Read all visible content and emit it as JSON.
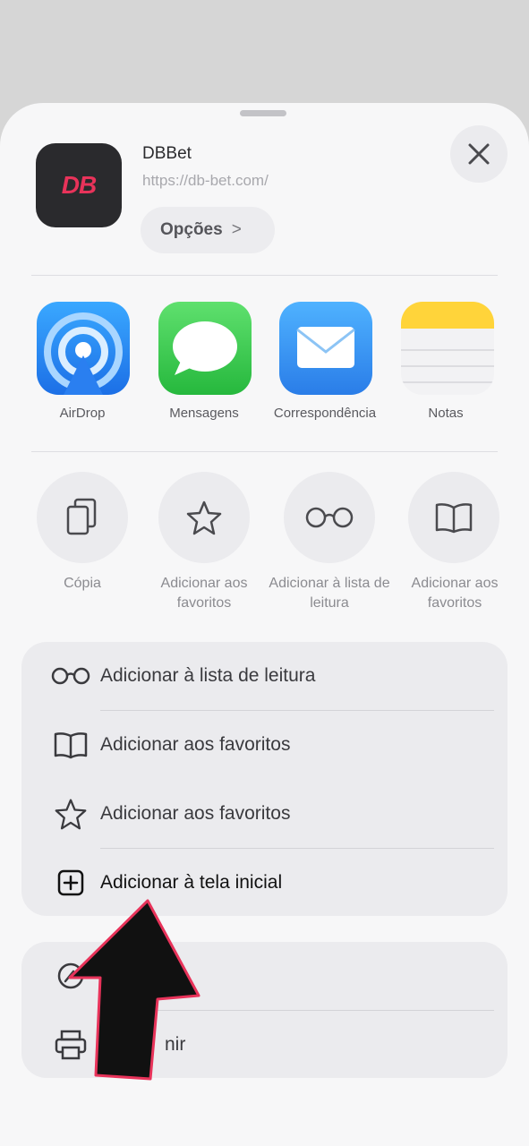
{
  "share_sheet": {
    "app": {
      "icon_text": "DB",
      "name": "DBBet",
      "url": "https://db-bet.com/",
      "options_label": "Opções",
      "options_chevron": ">"
    },
    "share_targets": [
      {
        "label": "AirDrop",
        "icon": "airdrop-icon"
      },
      {
        "label": "Mensagens",
        "icon": "messages-icon"
      },
      {
        "label": "Correspondência",
        "icon": "mail-icon"
      },
      {
        "label": "Notas",
        "icon": "notes-icon"
      }
    ],
    "actions": [
      {
        "label": "Cópia",
        "icon": "copy-icon"
      },
      {
        "label": "Adicionar aos favoritos",
        "icon": "star-icon"
      },
      {
        "label": "Adicionar à lista de leitura",
        "icon": "glasses-icon"
      },
      {
        "label": "Adicionar aos favoritos",
        "icon": "book-icon"
      }
    ],
    "menu_rows": [
      {
        "label": "Adicionar à lista de leitura",
        "icon": "glasses-icon"
      },
      {
        "label": "Adicionar aos favoritos",
        "icon": "book-icon"
      },
      {
        "label": "Adicionar aos favoritos",
        "icon": "star-icon"
      },
      {
        "label": "Adicionar à tela inicial",
        "icon": "add-square-icon"
      }
    ],
    "second_group_rows": [
      {
        "label": "",
        "icon": "markup-icon"
      },
      {
        "label": "nir",
        "icon": "printer-icon"
      }
    ]
  },
  "colors": {
    "brand_accent": "#e8335a",
    "arrow_fill": "#111111",
    "arrow_outline": "#e8335a"
  }
}
